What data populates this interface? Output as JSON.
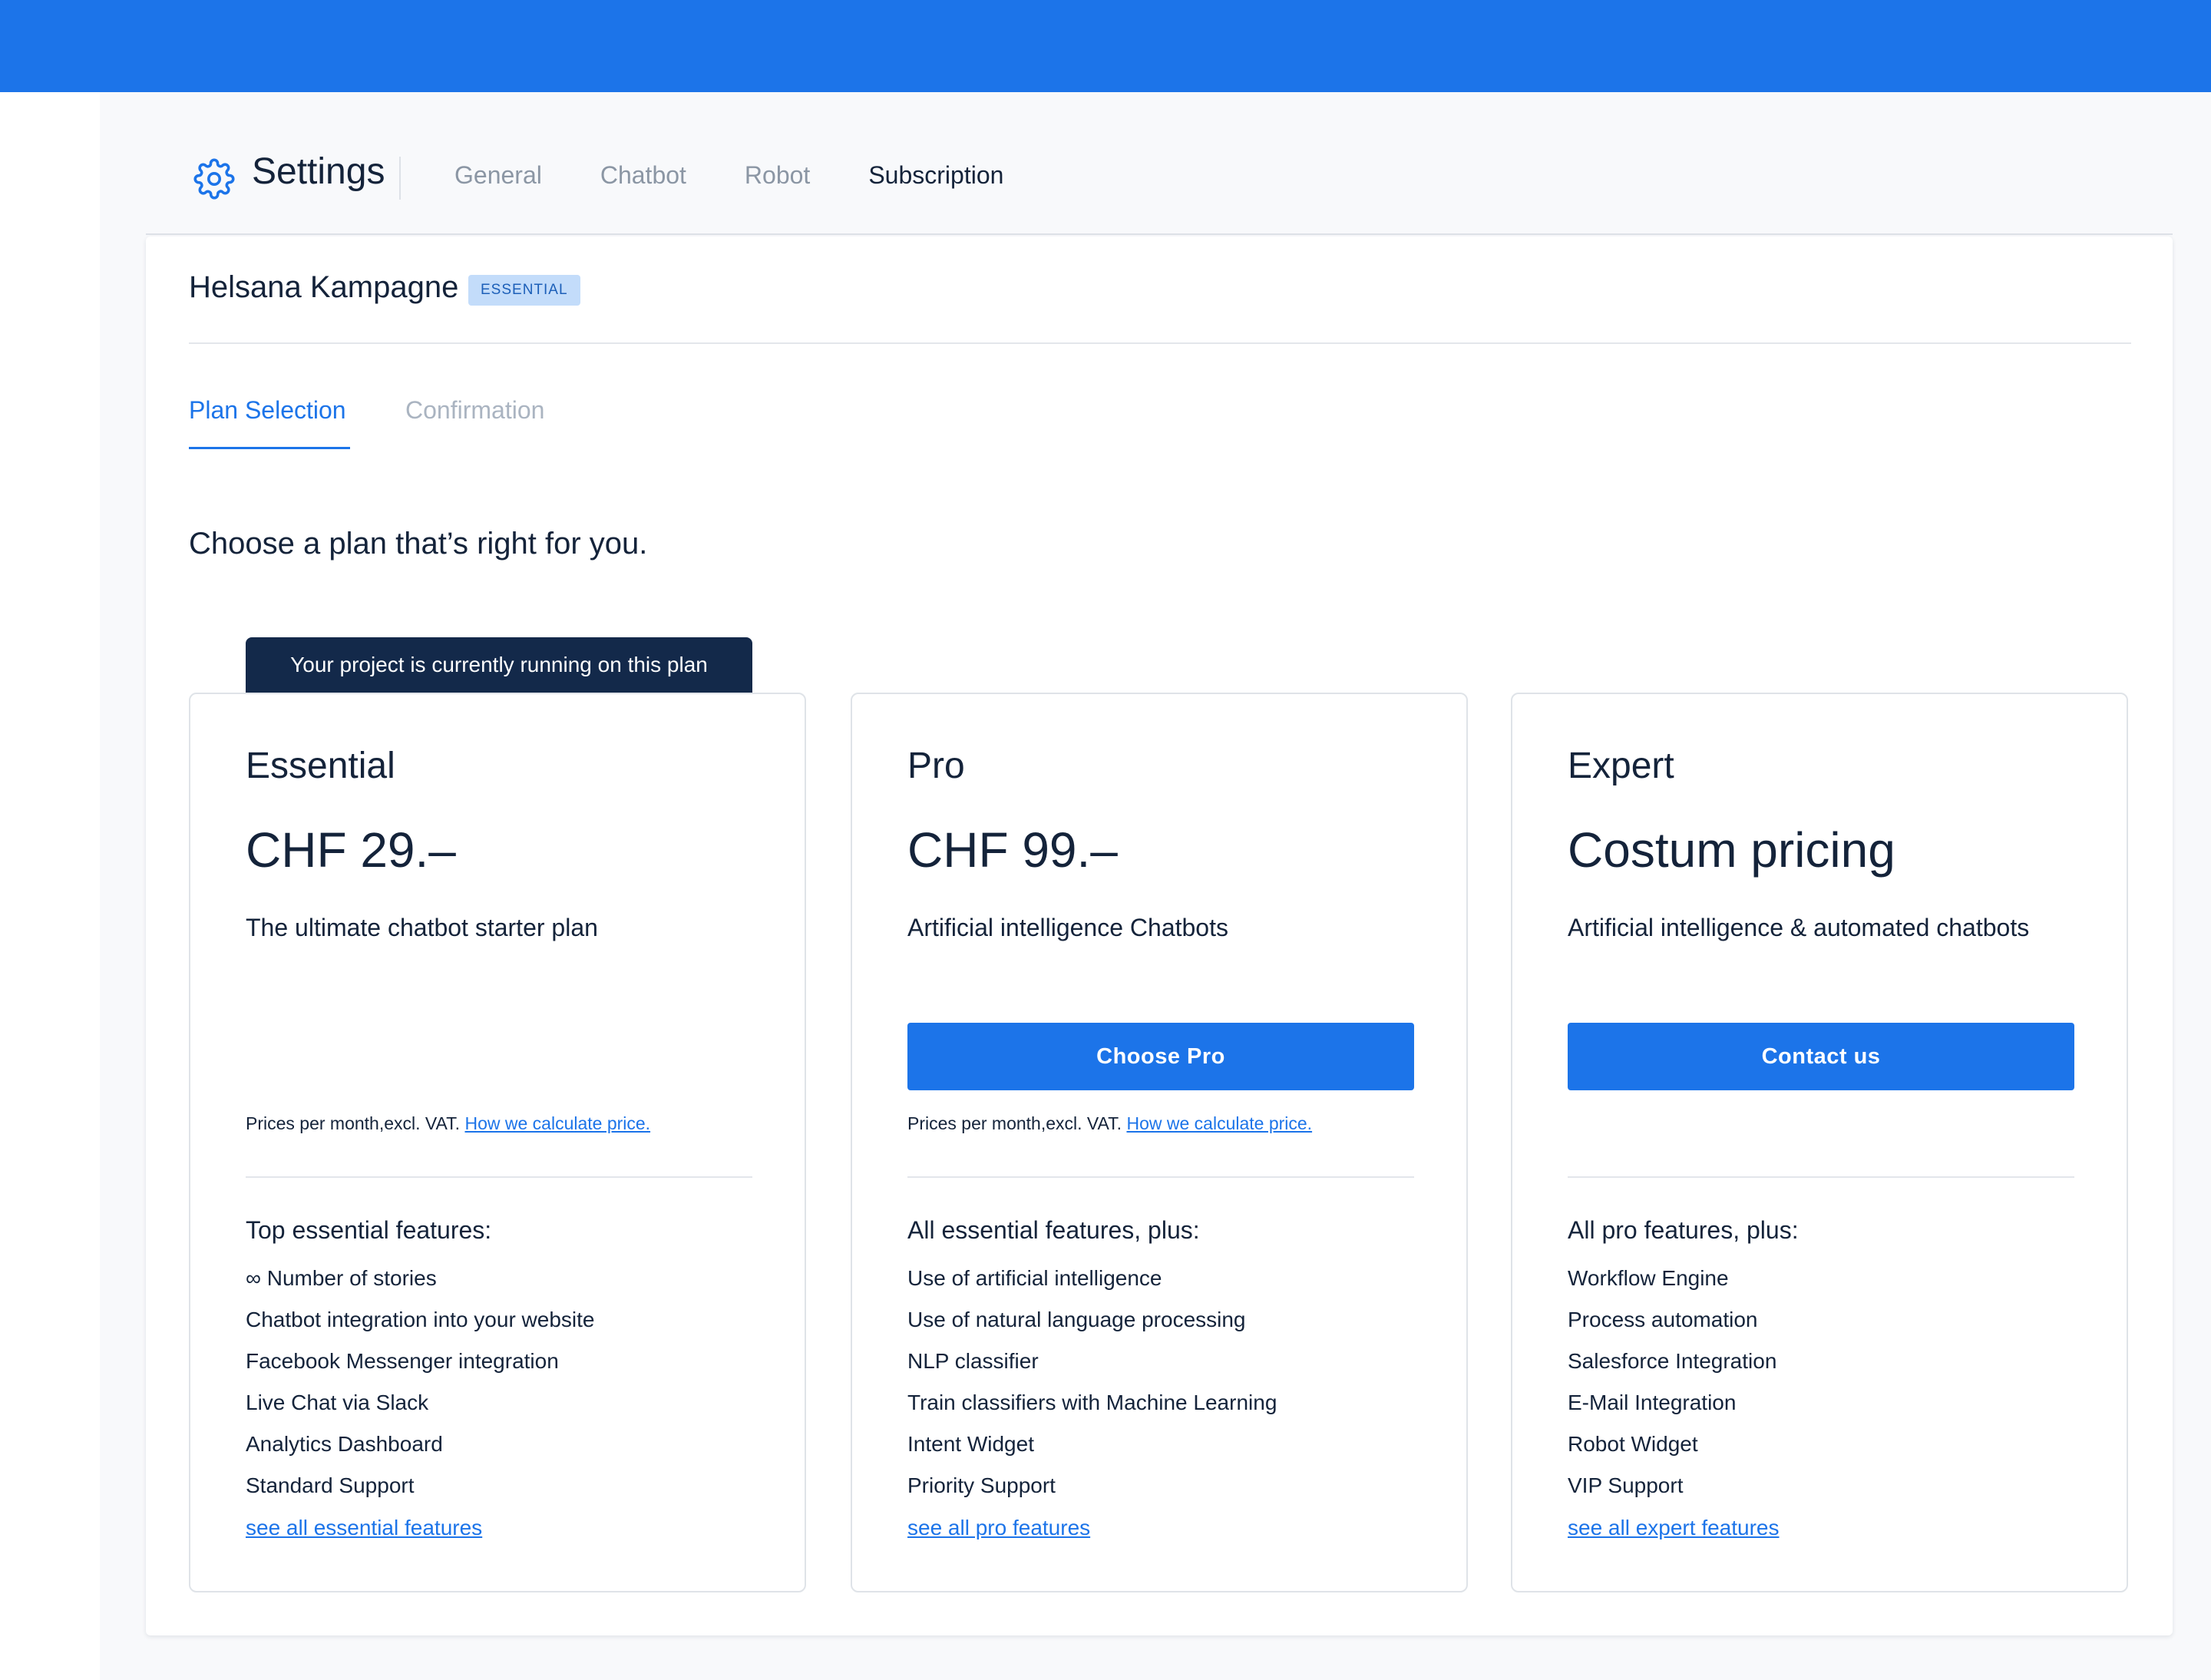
{
  "header": {
    "title": "Settings",
    "icon": "gear-icon",
    "nav": [
      {
        "label": "General"
      },
      {
        "label": "Chatbot"
      },
      {
        "label": "Robot"
      },
      {
        "label": "Subscription"
      }
    ],
    "active_nav": "Subscription"
  },
  "project": {
    "name": "Helsana Kampagne",
    "badge": "ESSENTIAL"
  },
  "steps": [
    {
      "label": "Plan Selection"
    },
    {
      "label": "Confirmation"
    }
  ],
  "subtitle": "Choose a plan that’s right for you.",
  "current_plan_label": "Your project is currently running on this plan",
  "plans": [
    {
      "name": "Essential",
      "price": "CHF 29.–",
      "description": "The ultimate chatbot starter plan",
      "note": "Prices per month,excl. VAT.",
      "note_link": "How we calculate price.",
      "features_heading": "Top essential features:",
      "features": [
        "∞ Number of stories",
        "Chatbot integration into your website",
        "Facebook Messenger integration",
        "Live Chat via Slack",
        "Analytics Dashboard",
        "Standard Support"
      ],
      "see_all": "see all essential features"
    },
    {
      "name": "Pro",
      "price": "CHF 99.–",
      "description": "Artificial intelligence Chatbots",
      "button": "Choose Pro",
      "note": "Prices per month,excl. VAT.",
      "note_link": "How we calculate price.",
      "features_heading": "All essential features, plus:",
      "features": [
        "Use of artificial intelligence",
        "Use of natural language processing",
        "NLP classifier",
        "Train classifiers with Machine Learning",
        "Intent Widget",
        "Priority Support"
      ],
      "see_all": "see all pro features"
    },
    {
      "name": "Expert",
      "price": "Costum pricing",
      "description": "Artificial intelligence & automated chatbots",
      "button": "Contact us",
      "features_heading": "All pro features, plus:",
      "features": [
        "Workflow Engine",
        "Process automation",
        "Salesforce Integration",
        "E-Mail Integration",
        "Robot Widget",
        "VIP Support"
      ],
      "see_all": "see all expert features"
    }
  ],
  "colors": {
    "accent": "#1c74e9",
    "dark": "#13294a",
    "text": "#14233a",
    "muted": "#8b96a4",
    "badge_bg": "#c3dcfa"
  }
}
